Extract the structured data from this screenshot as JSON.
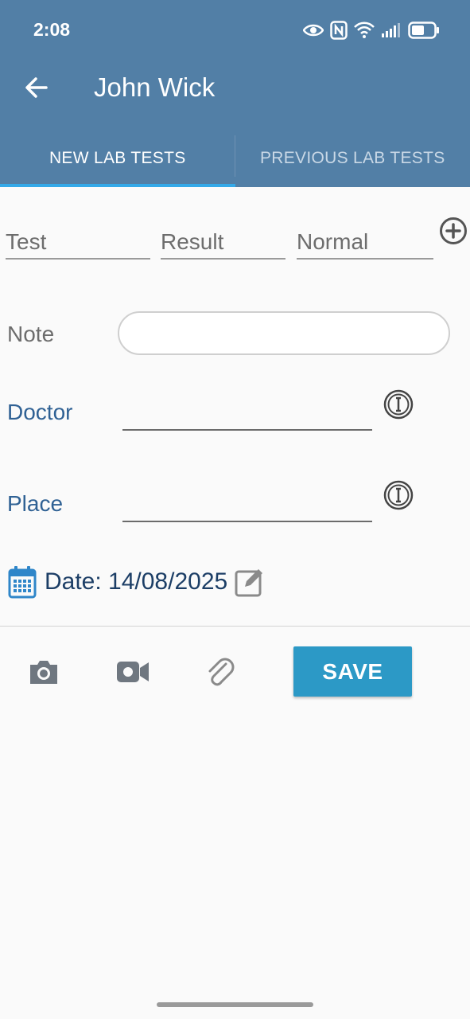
{
  "status_bar": {
    "time": "2:08",
    "icons": [
      "eye-icon",
      "nfc-icon",
      "wifi-icon",
      "signal-icon",
      "battery-icon"
    ]
  },
  "toolbar": {
    "title": "John Wick",
    "back_icon": "arrow-left-icon"
  },
  "tabs": [
    {
      "label": "NEW LAB TESTS",
      "active": true
    },
    {
      "label": "PREVIOUS LAB TESTS",
      "active": false
    }
  ],
  "lab_row": {
    "test_placeholder": "Test",
    "result_placeholder": "Result",
    "normal_placeholder": "Normal",
    "add_icon": "plus-circle-icon"
  },
  "form": {
    "note_label": "Note",
    "note_value": "",
    "doctor_label": "Doctor",
    "doctor_value": "",
    "place_label": "Place",
    "place_value": "",
    "info_icon": "info-circle-icon"
  },
  "date": {
    "text": "Date: 14/08/2025",
    "calendar_icon": "calendar-icon",
    "edit_icon": "edit-icon"
  },
  "actions": {
    "save_label": "SAVE",
    "icons": [
      "camera-icon",
      "video-icon",
      "paperclip-icon"
    ]
  },
  "colors": {
    "header": "#527fa6",
    "tab_indicator": "#34a9e8",
    "save_button": "#2c99c6",
    "label_blue": "#2f6194"
  }
}
